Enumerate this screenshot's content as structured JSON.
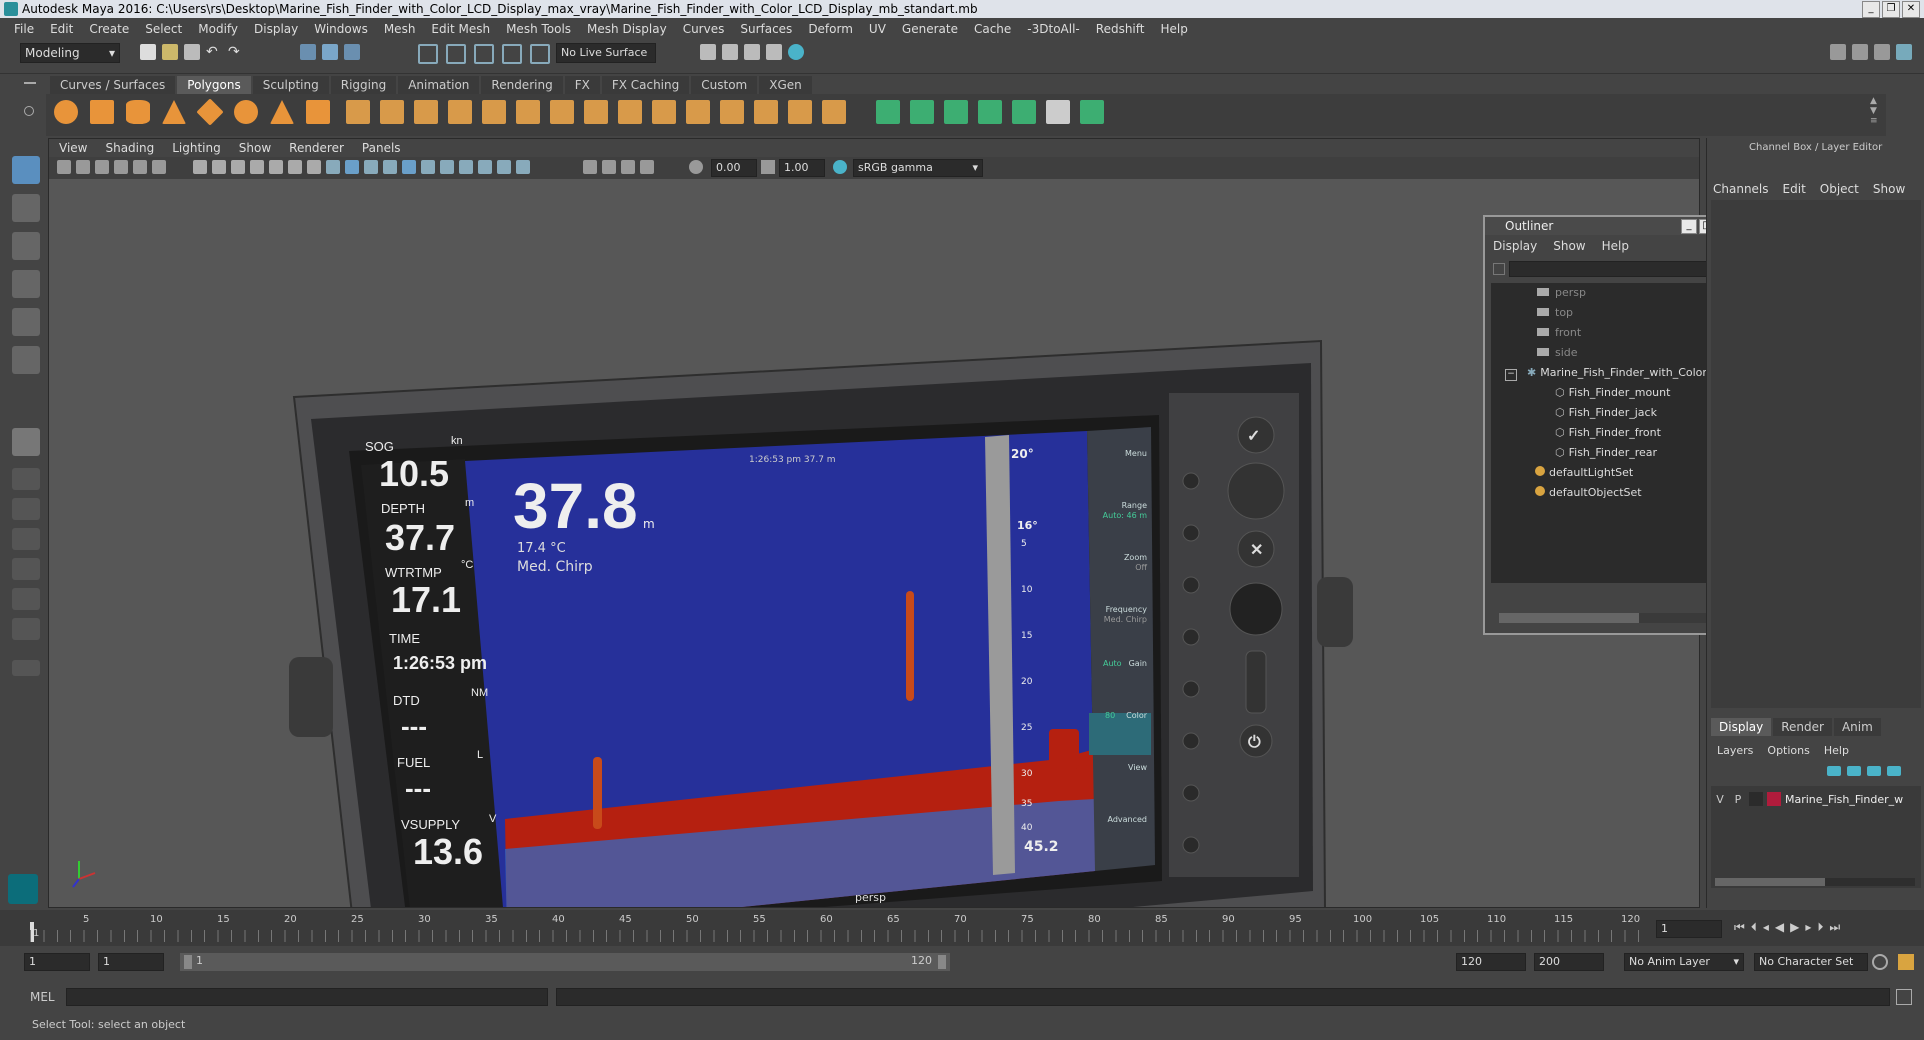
{
  "window": {
    "title": "Autodesk Maya 2016: C:\\Users\\rs\\Desktop\\Marine_Fish_Finder_with_Color_LCD_Display_max_vray\\Marine_Fish_Finder_with_Color_LCD_Display_mb_standart.mb",
    "controls": [
      "_",
      "❐",
      "✕"
    ]
  },
  "menubar": [
    "File",
    "Edit",
    "Create",
    "Select",
    "Modify",
    "Display",
    "Windows",
    "Mesh",
    "Edit Mesh",
    "Mesh Tools",
    "Mesh Display",
    "Curves",
    "Surfaces",
    "Deform",
    "UV",
    "Generate",
    "Cache",
    "-3DtoAll-",
    "Redshift",
    "Help"
  ],
  "status": {
    "mode": "Modeling",
    "live_surface": "No Live Surface"
  },
  "shelf": {
    "tabs": [
      "Curves / Surfaces",
      "Polygons",
      "Sculpting",
      "Rigging",
      "Animation",
      "Rendering",
      "FX",
      "FX Caching",
      "Custom",
      "XGen"
    ],
    "active_tab": "Polygons"
  },
  "viewport": {
    "menu": [
      "View",
      "Shading",
      "Lighting",
      "Show",
      "Renderer",
      "Panels"
    ],
    "near_value": "0.00",
    "far_value": "1.00",
    "color_space": "sRGB gamma",
    "camera_label": "persp"
  },
  "fishfinder_screen": {
    "header": "1:26:53 pm   37.7 m",
    "sog_label": "SOG",
    "sog_unit": "kn",
    "sog_value": "10.5",
    "depth_label": "DEPTH",
    "depth_unit": "m",
    "depth_value": "37.7",
    "wtrtmp_label": "WTRTMP",
    "wtrtmp_unit": "°C",
    "wtrtmp_value": "17.1",
    "time_label": "TIME",
    "time_value": "1:26:53 pm",
    "dtd_label": "DTD",
    "dtd_unit": "NM",
    "dtd_value": "---",
    "fuel_label": "FUEL",
    "fuel_unit": "L",
    "fuel_value": "---",
    "vsupply_label": "VSUPPLY",
    "vsupply_unit": "V",
    "vsupply_value": "13.6",
    "big_depth": "37.8",
    "big_depth_unit": "m",
    "temp_small": "17.4 °C",
    "mode_text": "Med. Chirp",
    "scale_top": "20°",
    "scale_mid": "16°",
    "scale_ticks": [
      "5",
      "10",
      "15",
      "20",
      "25",
      "30",
      "35",
      "40"
    ],
    "scale_bottom": "45.2",
    "side_menu": [
      "Menu",
      "Range",
      "Zoom",
      "Frequency",
      "Gain",
      "Color",
      "View",
      "Advanced"
    ],
    "range_sub": "Auto: 46 m",
    "zoom_sub": "Off",
    "freq_sub": "Med. Chirp",
    "gain_knob": "Auto",
    "color_knob": "80"
  },
  "outliner": {
    "title": "Outliner",
    "menu": [
      "Display",
      "Show",
      "Help"
    ],
    "items": [
      {
        "label": "persp",
        "indent": 2,
        "dim": true
      },
      {
        "label": "top",
        "indent": 2,
        "dim": true
      },
      {
        "label": "front",
        "indent": 2,
        "dim": true
      },
      {
        "label": "side",
        "indent": 2,
        "dim": true
      },
      {
        "label": "Marine_Fish_Finder_with_Color_L",
        "indent": 1,
        "dim": false
      },
      {
        "label": "Fish_Finder_mount",
        "indent": 3,
        "dim": false
      },
      {
        "label": "Fish_Finder_jack",
        "indent": 3,
        "dim": false
      },
      {
        "label": "Fish_Finder_front",
        "indent": 3,
        "dim": false
      },
      {
        "label": "Fish_Finder_rear",
        "indent": 3,
        "dim": false
      },
      {
        "label": "defaultLightSet",
        "indent": 2,
        "dim": false
      },
      {
        "label": "defaultObjectSet",
        "indent": 2,
        "dim": false
      }
    ]
  },
  "channelbox": {
    "title": "Channel Box / Layer Editor",
    "menu": [
      "Channels",
      "Edit",
      "Object",
      "Show"
    ],
    "tabs": [
      "Display",
      "Render",
      "Anim"
    ],
    "layer_menu": [
      "Layers",
      "Options",
      "Help"
    ],
    "layer": {
      "v": "V",
      "p": "P",
      "name": "Marine_Fish_Finder_w",
      "color": "#b01c3c"
    }
  },
  "timeline": {
    "ticks": [
      "1",
      "5",
      "10",
      "15",
      "20",
      "25",
      "30",
      "35",
      "40",
      "45",
      "50",
      "55",
      "60",
      "65",
      "70",
      "75",
      "80",
      "85",
      "90",
      "95",
      "100",
      "105",
      "110",
      "115",
      "120"
    ],
    "current_frame": "1",
    "range_start": "1",
    "range_inner_start": "1",
    "range_slider_start": "1",
    "range_slider_end": "120",
    "range_end": "120",
    "anim_end": "200",
    "anim_layer": "No Anim Layer",
    "character_set": "No Character Set"
  },
  "cmdline": {
    "label": "MEL"
  },
  "helpline": {
    "text": "Select Tool: select an object"
  },
  "colors": {
    "accent": "#5a8fbf",
    "sonar_bg": "#26309a",
    "bottom_red": "#b52010",
    "layer_red": "#b01c3c"
  }
}
